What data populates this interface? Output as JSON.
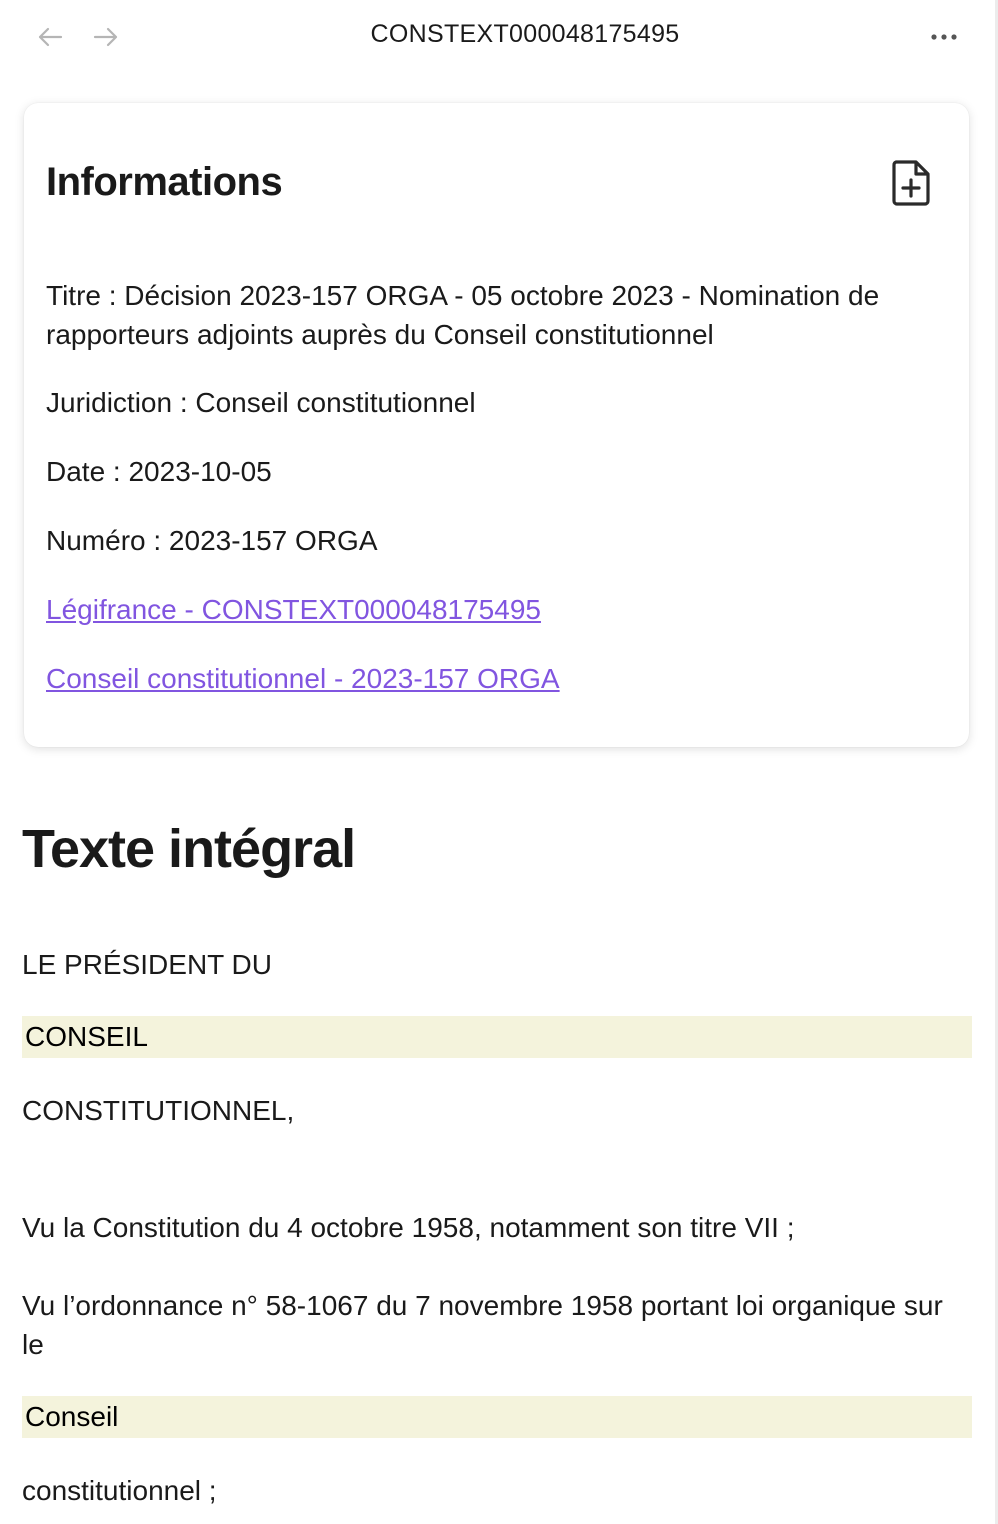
{
  "topbar": {
    "title": "CONSTEXT000048175495",
    "back_icon": "arrow-left-icon",
    "forward_icon": "arrow-right-icon",
    "more_icon": "more-horizontal-icon"
  },
  "info": {
    "heading": "Informations",
    "action_icon": "file-plus-icon",
    "titre": "Titre : Décision 2023-157 ORGA - 05 octobre 2023 - Nomination de rapporteurs adjoints auprès du Conseil constitutionnel",
    "juridiction": "Juridiction : Conseil constitutionnel",
    "date": "Date : 2023-10-05",
    "numero": "Numéro : 2023-157 ORGA",
    "link_legifrance": "Légifrance - CONSTEXT000048175495",
    "link_conseil": "Conseil constitutionnel - 2023-157 ORGA",
    "link_color": "#8155e0"
  },
  "full_text": {
    "heading": "Texte intégral",
    "p1": "LE PRÉSIDENT DU",
    "highlight1": "CONSEIL",
    "p3": "CONSTITUTIONNEL,",
    "p4": "Vu la Constitution du 4 octobre 1958, notamment son titre VII ;",
    "p5": "Vu l’ordonnance n° 58-1067 du 7 novembre 1958 portant loi organique sur le",
    "highlight2": "Conseil",
    "p6": "constitutionnel ;",
    "highlight_color": "#f4f3dc"
  }
}
